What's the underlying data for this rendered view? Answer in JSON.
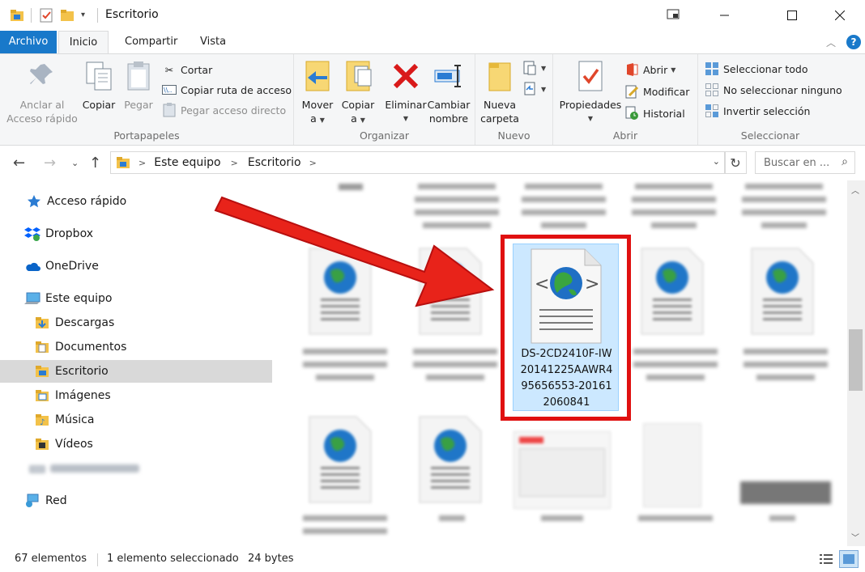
{
  "window": {
    "title": "Escritorio",
    "controls": [
      "minimize-icon",
      "maximize-icon",
      "close-icon"
    ]
  },
  "tabs": {
    "file": "Archivo",
    "home": "Inicio",
    "share": "Compartir",
    "view": "Vista"
  },
  "ribbon": {
    "portapapeles": {
      "label": "Portapapeles",
      "pin": [
        "Anclar al",
        "Acceso rápido"
      ],
      "copy": "Copiar",
      "paste": "Pegar",
      "cut": "Cortar",
      "copy_path": "Copiar ruta de acceso",
      "paste_shortcut": "Pegar acceso directo"
    },
    "organizar": {
      "label": "Organizar",
      "move": [
        "Mover",
        "a"
      ],
      "copy_to": [
        "Copiar",
        "a"
      ],
      "delete": "Eliminar",
      "rename": [
        "Cambiar",
        "nombre"
      ]
    },
    "nuevo": {
      "label": "Nuevo",
      "new_folder": [
        "Nueva",
        "carpeta"
      ]
    },
    "abrir": {
      "label": "Abrir",
      "properties": "Propiedades",
      "open": "Abrir",
      "edit": "Modificar",
      "history": "Historial"
    },
    "seleccionar": {
      "label": "Seleccionar",
      "select_all": "Seleccionar todo",
      "select_none": "No seleccionar ninguno",
      "invert": "Invertir selección"
    }
  },
  "address": {
    "crumbs": [
      "Este equipo",
      "Escritorio"
    ],
    "search_placeholder": "Buscar en ..."
  },
  "sidebar": {
    "items": [
      {
        "label": "Acceso rápido",
        "icon": "star-icon"
      },
      {
        "label": "Dropbox",
        "icon": "dropbox-icon"
      },
      {
        "label": "OneDrive",
        "icon": "cloud-icon"
      },
      {
        "label": "Este equipo",
        "icon": "computer-icon"
      },
      {
        "label": "Descargas",
        "icon": "download-folder-icon"
      },
      {
        "label": "Documentos",
        "icon": "documents-folder-icon"
      },
      {
        "label": "Escritorio",
        "icon": "desktop-folder-icon",
        "selected": true
      },
      {
        "label": "Imágenes",
        "icon": "pictures-folder-icon"
      },
      {
        "label": "Música",
        "icon": "music-folder-icon"
      },
      {
        "label": "Vídeos",
        "icon": "videos-folder-icon"
      },
      {
        "label": "Red",
        "icon": "network-icon"
      }
    ]
  },
  "content": {
    "selected_file": {
      "name_lines": [
        "DS-2CD2410F-IW",
        "20141225AAWR4",
        "95656553-20161",
        "2060841"
      ],
      "icon": "html-file-icon"
    }
  },
  "status": {
    "count": "67 elementos",
    "selection": "1 elemento seleccionado",
    "size": "24 bytes"
  }
}
